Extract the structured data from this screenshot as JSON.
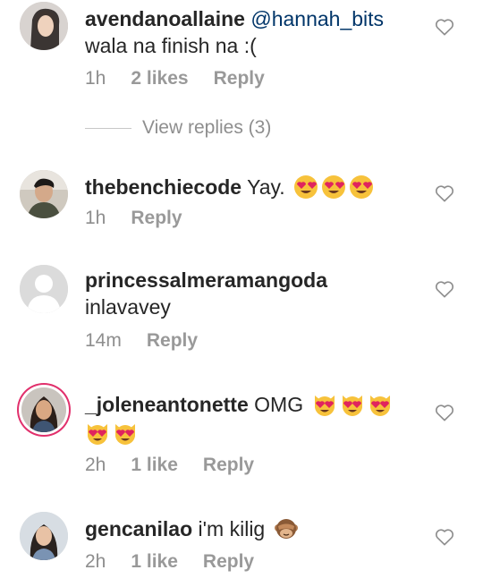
{
  "comments": [
    {
      "username": "avendanoallaine",
      "mention": "@hannah_bits",
      "text": "wala na finish na :(",
      "time": "1h",
      "likes": "2 likes",
      "reply": "Reply"
    },
    {
      "username": "thebenchiecode",
      "text": "Yay.",
      "time": "1h",
      "reply": "Reply"
    },
    {
      "username": "princessalmeramangoda",
      "text": "inlavavey",
      "time": "14m",
      "reply": "Reply"
    },
    {
      "username": "_joleneantonette",
      "text": "OMG",
      "time": "2h",
      "likes": "1 like",
      "reply": "Reply"
    },
    {
      "username": "gencanilao",
      "text": "i'm kilig",
      "time": "2h",
      "likes": "1 like",
      "reply": "Reply"
    }
  ],
  "view_replies": "View replies (3)",
  "icons": {
    "heart": "heart-outline-icon",
    "heart_eyes": "smiling-face-heart-eyes-emoji",
    "cat_heart_eyes": "cat-heart-eyes-emoji",
    "see_no_evil": "see-no-evil-monkey-emoji"
  },
  "colors": {
    "username": "#262626",
    "mention": "#003569",
    "meta": "#8e8e8e",
    "story_ring": "#e1306c"
  }
}
